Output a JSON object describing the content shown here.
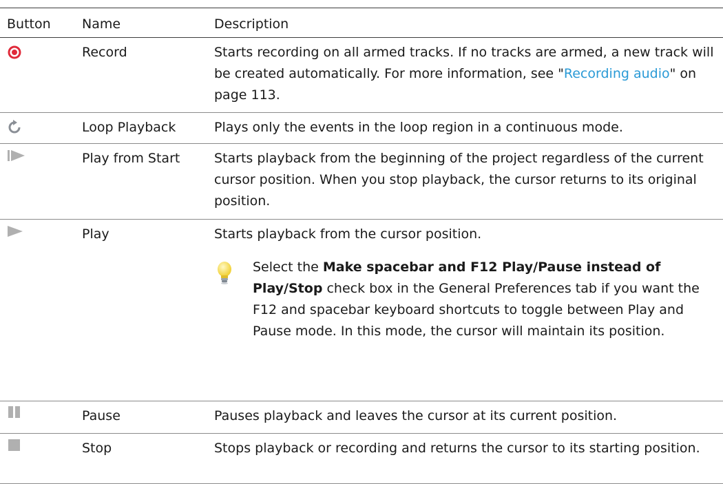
{
  "table": {
    "headers": {
      "button": "Button",
      "name": "Name",
      "description": "Description"
    },
    "rows": [
      {
        "icon": "record-icon",
        "name": "Record",
        "desc_before": "Starts recording on all armed tracks. If no tracks are armed, a new track will be created automatically. For more information, see \"",
        "link": "Recording audio",
        "desc_after": "\" on page 113."
      },
      {
        "icon": "loop-icon",
        "name": "Loop Playback",
        "description": "Plays only the events in the loop region in a continuous mode."
      },
      {
        "icon": "play-from-start-icon",
        "name": "Play from Start",
        "description": "Starts playback from the beginning of the project regardless of the current cursor position. When you stop playback, the cursor returns to its original position."
      },
      {
        "icon": "play-icon",
        "name": "Play",
        "description": "Starts playback from the cursor position.",
        "tip": {
          "icon": "lightbulb-icon",
          "before": "Select the ",
          "bold": "Make spacebar and F12 Play/Pause instead of Play/Stop",
          "after": " check box in the General Preferences tab if you want the F12 and spacebar keyboard shortcuts to toggle between Play and Pause mode. In this mode, the cursor will maintain its position."
        }
      },
      {
        "icon": "pause-icon",
        "name": "Pause",
        "description": "Pauses playback and leaves the cursor at its current position."
      },
      {
        "icon": "stop-icon",
        "name": "Stop",
        "description": "Stops playback or recording and returns the cursor to its starting position."
      }
    ]
  }
}
